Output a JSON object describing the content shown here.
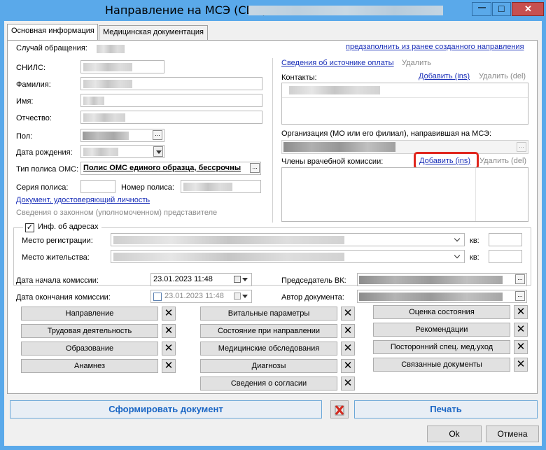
{
  "window": {
    "title": "Направление на МСЭ (CDA) -",
    "minimize_glyph": "—",
    "maximize_glyph": "□",
    "close_glyph": "✕"
  },
  "tabs": [
    {
      "label": "Основная информация"
    },
    {
      "label": "Медицинская документация"
    }
  ],
  "case": {
    "label": "Случай обращения:",
    "prefill_link": "предзаполнить из ранее созданного направления"
  },
  "patient": {
    "snils_label": "СНИЛС:",
    "lastname_label": "Фамилия:",
    "firstname_label": "Имя:",
    "patronymic_label": "Отчество:",
    "sex_label": "Пол:",
    "birthdate_label": "Дата рождения:",
    "policy_type_label": "Тип полиса ОМС:",
    "policy_type_value": "Полис ОМС единого образца, бессрочны",
    "policy_series_label": "Серия полиса:",
    "policy_number_label": "Номер полиса:",
    "id_doc_link": "Документ, удостоверяющий личность",
    "representative_label": "Сведения о законном (уполномоченном) представителе",
    "ellipsis": "..."
  },
  "right": {
    "payment_source_link": "Сведения об источнике оплаты",
    "payment_delete": "Удалить",
    "contacts_label": "Контакты:",
    "add_ins": "Добавить (ins)",
    "delete_del": "Удалить (del)",
    "org_label": "Организация (МО или его филиал), направившая на МСЭ:",
    "commission_label": "Члены врачебной комиссии:"
  },
  "addresses": {
    "header": "Инф. об адресах",
    "checked_glyph": "✓",
    "registration_label": "Место регистрации:",
    "residence_label": "Место жительства:",
    "apt_label": "кв:"
  },
  "commission": {
    "start_label": "Дата начала комиссии:",
    "start_value": "23.01.2023 11:48",
    "end_label": "Дата окончания комиссии:",
    "end_value": "23.01.2023 11:48",
    "chairman_label": "Председатель ВК:",
    "author_label": "Автор документа:"
  },
  "section_buttons": {
    "col1": [
      "Направление",
      "Трудовая деятельность",
      "Образование",
      "Анамнез"
    ],
    "col2": [
      "Витальные параметры",
      "Состояние при направлении",
      "Медицинские обследования",
      "Диагнозы",
      "Сведения о согласии"
    ],
    "col3": [
      "Оценка состояния",
      "Рекомендации",
      "Посторонний спец. мед.уход",
      "Связанные документы"
    ],
    "remove_glyph": "✕"
  },
  "footer": {
    "generate": "Сформировать документ",
    "print": "Печать",
    "ok": "Ok",
    "cancel": "Отмена"
  },
  "colors": {
    "titlebar": "#5aa9ea",
    "link": "#1a2fb8",
    "highlight": "#e0261d",
    "primary_text": "#1a66c4"
  }
}
